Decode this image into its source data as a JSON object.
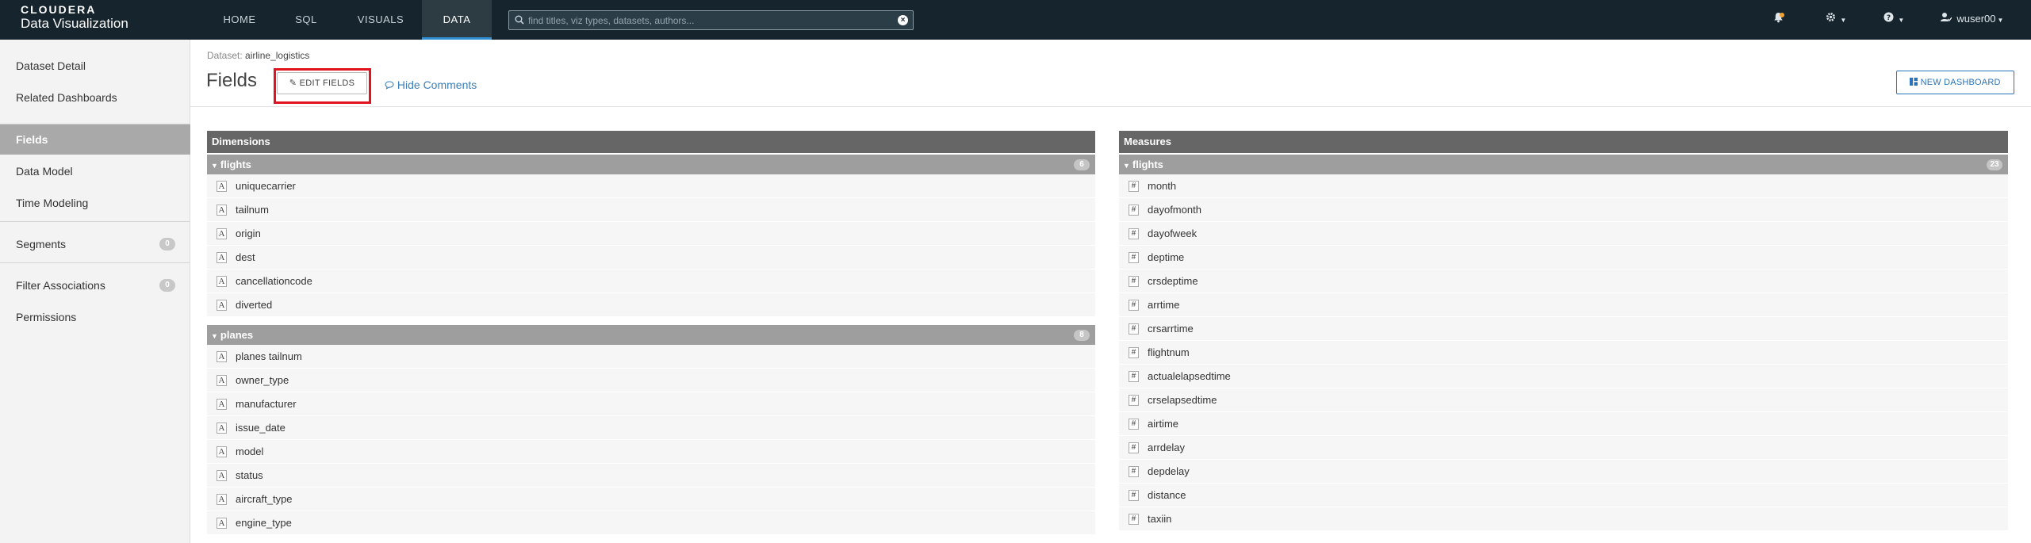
{
  "brand": {
    "line1": "CLOUDERA",
    "line2": "Data Visualization"
  },
  "nav": {
    "tabs": [
      "HOME",
      "SQL",
      "VISUALS",
      "DATA"
    ],
    "active": "DATA"
  },
  "search": {
    "placeholder": "find titles, viz types, datasets, authors..."
  },
  "user": {
    "name": "wuser00"
  },
  "sidebar": {
    "items": [
      {
        "label": "Dataset Detail"
      },
      {
        "label": "Related Dashboards"
      },
      {
        "label": "Fields"
      },
      {
        "label": "Data Model"
      },
      {
        "label": "Time Modeling"
      },
      {
        "label": "Segments",
        "badge": "0"
      },
      {
        "label": "Filter Associations",
        "badge": "0"
      },
      {
        "label": "Permissions"
      }
    ],
    "active": "Fields"
  },
  "header": {
    "dataset_label": "Dataset:",
    "dataset_name": "airline_logistics",
    "title": "Fields",
    "edit_fields": "EDIT FIELDS",
    "hide_comments": "Hide Comments",
    "new_dashboard": "NEW DASHBOARD"
  },
  "dimensions": {
    "title": "Dimensions",
    "groups": [
      {
        "name": "flights",
        "count": "6",
        "fields": [
          "uniquecarrier",
          "tailnum",
          "origin",
          "dest",
          "cancellationcode",
          "diverted"
        ]
      },
      {
        "name": "planes",
        "count": "8",
        "fields": [
          "planes tailnum",
          "owner_type",
          "manufacturer",
          "issue_date",
          "model",
          "status",
          "aircraft_type",
          "engine_type"
        ]
      }
    ]
  },
  "measures": {
    "title": "Measures",
    "groups": [
      {
        "name": "flights",
        "count": "23",
        "fields": [
          "month",
          "dayofmonth",
          "dayofweek",
          "deptime",
          "crsdeptime",
          "arrtime",
          "crsarrtime",
          "flightnum",
          "actualelapsedtime",
          "crselapsedtime",
          "airtime",
          "arrdelay",
          "depdelay",
          "distance",
          "taxiin"
        ]
      }
    ]
  },
  "icons": {
    "dimension_field": "A",
    "measure_field": "#"
  },
  "colors": {
    "topbar": "#16252d",
    "accent": "#2f8ed0",
    "highlight": "#e0141e",
    "link": "#3b7fb9"
  }
}
